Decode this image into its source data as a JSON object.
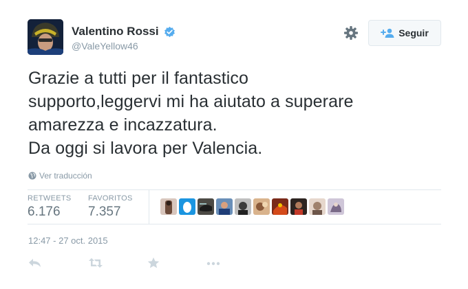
{
  "user": {
    "display_name": "Valentino Rossi",
    "handle": "@ValeYellow46",
    "verified": true
  },
  "follow_button": {
    "label": "Seguir"
  },
  "tweet": {
    "lines": [
      "Grazie a tutti per il fantastico",
      "supporto,leggervi mi ha aiutato a superare",
      "amarezza e incazzatura.",
      "Da oggi si lavora per Valencia."
    ]
  },
  "translate": {
    "label": "Ver traducción"
  },
  "stats": {
    "retweets_label": "RETWEETS",
    "retweets_value": "6.176",
    "favorites_label": "FAVORITOS",
    "favorites_value": "7.357"
  },
  "favorited_by_avatar_count": 10,
  "timestamp": "12:47 - 27 oct. 2015",
  "colors": {
    "text": "#292f33",
    "muted": "#8899a6",
    "verified": "#55acee",
    "action_icon": "#ccd6dd",
    "border": "#e1e8ed"
  },
  "icons": {
    "settings": "gear-icon",
    "follow": "follow-person-plus-icon",
    "translate": "globe-icon",
    "reply": "reply-icon",
    "retweet": "retweet-icon",
    "favorite": "star-icon",
    "more": "more-dots-icon"
  }
}
